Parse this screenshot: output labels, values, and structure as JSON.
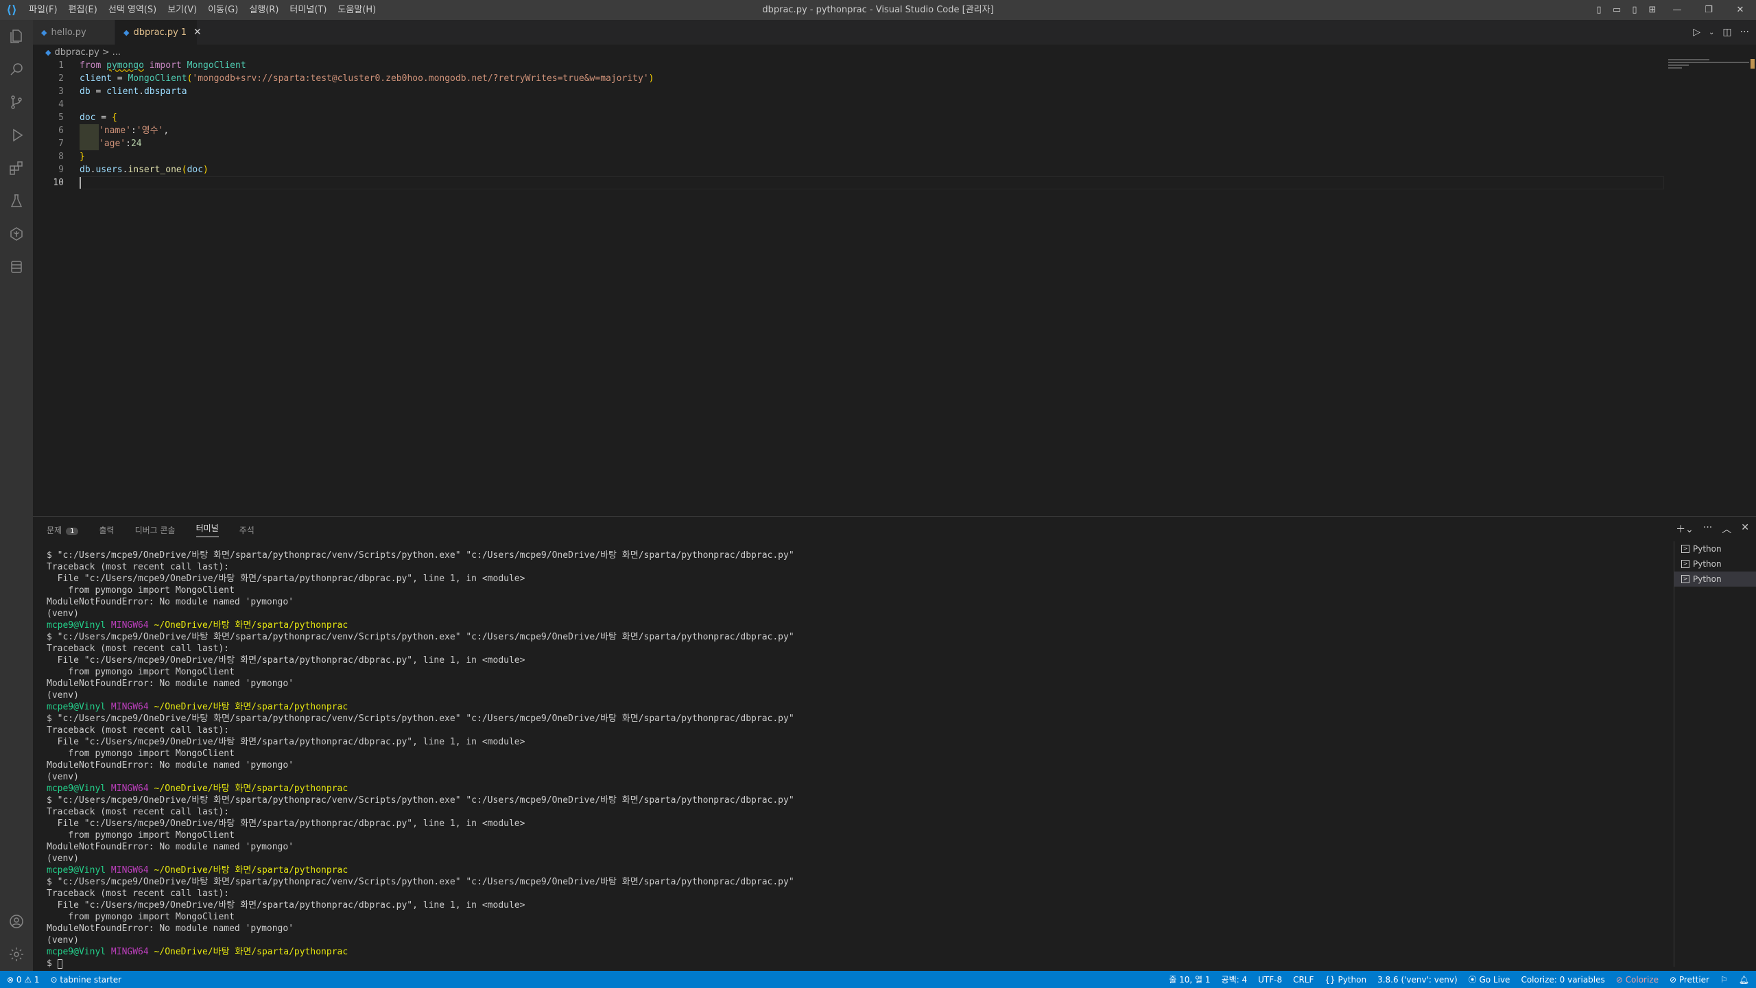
{
  "window": {
    "title": "dbprac.py - pythonprac - Visual Studio Code [관리자]"
  },
  "menu": [
    "파일(F)",
    "편집(E)",
    "선택 영역(S)",
    "보기(V)",
    "이동(G)",
    "실행(R)",
    "터미널(T)",
    "도움말(H)"
  ],
  "tabs": [
    {
      "label": "hello.py"
    },
    {
      "label": "dbprac.py",
      "modified": "1"
    }
  ],
  "breadcrumb": {
    "file": "dbprac.py",
    "sep": ">",
    "rest": "..."
  },
  "editor": {
    "line_numbers": [
      "1",
      "2",
      "3",
      "4",
      "5",
      "6",
      "7",
      "8",
      "9",
      "10"
    ],
    "l1": {
      "from": "from",
      "mod": "pymongo",
      "imp": "import",
      "cls": "MongoClient"
    },
    "l2": {
      "var": "client",
      "eq": " = ",
      "fn": "MongoClient",
      "open": "(",
      "str": "'mongodb+srv://sparta:test@cluster0.zeb0hoo.mongodb.net/?retryWrites=true&w=majority'",
      "close": ")"
    },
    "l3": {
      "var": "db",
      "eq": " = ",
      "obj": "client",
      "dot": ".",
      "attr": "dbsparta"
    },
    "l5": {
      "var": "doc",
      "eq": " = ",
      "brace": "{"
    },
    "l6": {
      "key": "'name'",
      "colon": ":",
      "val": "'영수'",
      "comma": ","
    },
    "l7": {
      "key": "'age'",
      "colon": ":",
      "val": "24"
    },
    "l8": {
      "brace": "}"
    },
    "l9": {
      "obj": "db",
      "dot1": ".",
      "attr": "users",
      "dot2": ".",
      "fn": "insert_one",
      "open": "(",
      "arg": "doc",
      "close": ")"
    }
  },
  "panel": {
    "tabs": {
      "problems": "문제",
      "problems_count": "1",
      "output": "출력",
      "debug": "디버그 콘솔",
      "terminal": "터미널",
      "comments": "주석"
    },
    "terminal": {
      "cmd": "$ \"c:/Users/mcpe9/OneDrive/바탕 화면/sparta/pythonprac/venv/Scripts/python.exe\" \"c:/Users/mcpe9/OneDrive/바탕 화면/sparta/pythonprac/dbprac.py\"",
      "tb": "Traceback (most recent call last):",
      "file": "  File \"c:/Users/mcpe9/OneDrive/바탕 화면/sparta/pythonprac/dbprac.py\", line 1, in <module>",
      "src": "    from pymongo import MongoClient",
      "err": "ModuleNotFoundError: No module named 'pymongo'",
      "venv": "(venv)",
      "user": "mcpe9@Vinyl",
      "mingw": "MINGW64",
      "path": "~/OneDrive/바탕 화면/sparta/pythonprac",
      "prompt": "$ "
    },
    "terminal_list": [
      "Python",
      "Python",
      "Python"
    ]
  },
  "statusbar": {
    "errors": "⊗ 0 ⚠ 1",
    "tabnine": "⊙ tabnine starter",
    "position": "줄 10, 열 1",
    "spaces": "공백: 4",
    "encoding": "UTF-8",
    "eol": "CRLF",
    "language": "{} Python",
    "interpreter": "3.8.6 ('venv': venv)",
    "golive": "⦿ Go Live",
    "colorize_vars": "Colorize: 0 variables",
    "colorize": "⊘ Colorize",
    "prettier": "⊘ Prettier"
  },
  "colors": {
    "accent": "#007acc",
    "titlebar": "#3c3c3c",
    "editor_bg": "#1e1e1e"
  }
}
